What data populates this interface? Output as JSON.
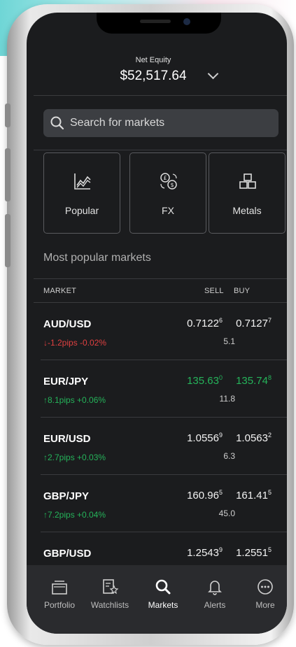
{
  "header": {
    "equity_label": "Net Equity",
    "equity_value": "$52,517.64"
  },
  "search": {
    "placeholder": "Search for markets"
  },
  "categories": [
    {
      "label": "Popular",
      "icon": "chart-line-icon"
    },
    {
      "label": "FX",
      "icon": "currency-exchange-icon"
    },
    {
      "label": "Metals",
      "icon": "metal-bars-icon"
    }
  ],
  "section_title": "Most popular markets",
  "columns": {
    "market": "MARKET",
    "sell": "SELL",
    "buy": "BUY"
  },
  "markets": [
    {
      "symbol": "AUD/USD",
      "change": "-1.2pips -0.02%",
      "direction": "down",
      "sell": "0.7122",
      "sell_sup": "6",
      "buy": "0.7127",
      "buy_sup": "7",
      "spread": "5.1",
      "price_color": "#f2f2f2"
    },
    {
      "symbol": "EUR/JPY",
      "change": "8.1pips +0.06%",
      "direction": "up",
      "sell": "135.63",
      "sell_sup": "0",
      "buy": "135.74",
      "buy_sup": "8",
      "spread": "11.8",
      "price_color": "#25b35a"
    },
    {
      "symbol": "EUR/USD",
      "change": "2.7pips +0.03%",
      "direction": "up",
      "sell": "1.0556",
      "sell_sup": "9",
      "buy": "1.0563",
      "buy_sup": "2",
      "spread": "6.3",
      "price_color": "#f2f2f2"
    },
    {
      "symbol": "GBP/JPY",
      "change": "7.2pips +0.04%",
      "direction": "up",
      "sell": "160.96",
      "sell_sup": "5",
      "buy": "161.41",
      "buy_sup": "5",
      "spread": "45.0",
      "price_color": "#f2f2f2"
    },
    {
      "symbol": "GBP/USD",
      "change": "",
      "direction": "",
      "sell": "1.2543",
      "sell_sup": "9",
      "buy": "1.2551",
      "buy_sup": "5",
      "spread": "",
      "price_color": "#f2f2f2"
    }
  ],
  "tabs": [
    {
      "label": "Portfolio",
      "icon": "portfolio-icon",
      "active": false
    },
    {
      "label": "Watchlists",
      "icon": "watchlist-icon",
      "active": false
    },
    {
      "label": "Markets",
      "icon": "search-icon",
      "active": true
    },
    {
      "label": "Alerts",
      "icon": "bell-icon",
      "active": false
    },
    {
      "label": "More",
      "icon": "more-icon",
      "active": false
    }
  ],
  "colors": {
    "up": "#25b35a",
    "down": "#e04040",
    "background": "#1b1c1e"
  }
}
